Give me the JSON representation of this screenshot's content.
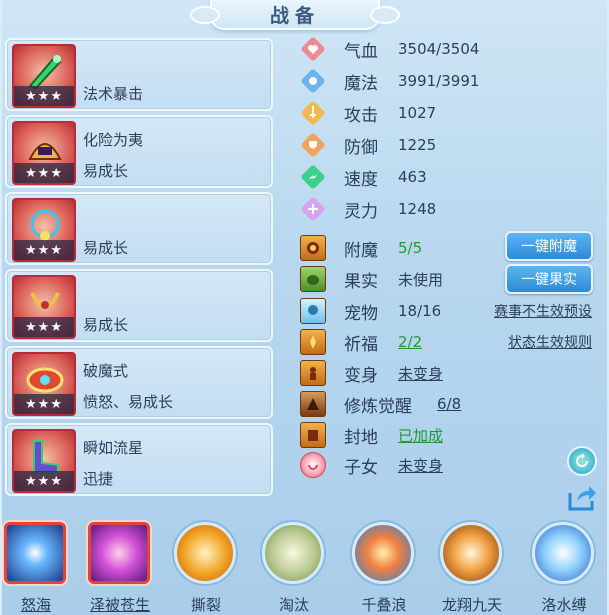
{
  "title": "战备",
  "equipment": [
    {
      "name": "",
      "attr": "法术暴击",
      "stars": "★★★"
    },
    {
      "name": "化险为夷",
      "attr": "易成长",
      "stars": "★★★"
    },
    {
      "name": "",
      "attr": "易成长",
      "stars": "★★★"
    },
    {
      "name": "",
      "attr": "易成长",
      "stars": "★★★"
    },
    {
      "name": "破魔式",
      "attr": "愤怒、易成长",
      "stars": "★★★"
    },
    {
      "name": "瞬如流星",
      "attr": "迅捷",
      "stars": "★★★"
    }
  ],
  "stats": [
    {
      "label": "气血",
      "value": "3504/3504",
      "icon": "heart-icon",
      "color": "#e85a6e"
    },
    {
      "label": "魔法",
      "value": "3991/3991",
      "icon": "mana-icon",
      "color": "#4c9be8"
    },
    {
      "label": "攻击",
      "value": "1027",
      "icon": "sword-icon",
      "color": "#f0a33a"
    },
    {
      "label": "防御",
      "value": "1225",
      "icon": "shield-icon",
      "color": "#f08a3a"
    },
    {
      "label": "速度",
      "value": "463",
      "icon": "speed-icon",
      "color": "#2fbf7a"
    },
    {
      "label": "灵力",
      "value": "1248",
      "icon": "spirit-icon",
      "color": "#c58be6"
    }
  ],
  "extras": [
    {
      "label": "附魔",
      "value": "5/5"
    },
    {
      "label": "果实",
      "value": "未使用"
    },
    {
      "label": "宠物",
      "value": "18/16"
    },
    {
      "label": "祈福",
      "value": "2/2"
    },
    {
      "label": "变身",
      "value": "未变身"
    },
    {
      "label": "修炼觉醒",
      "value": "6/8"
    },
    {
      "label": "封地",
      "value": "已加成"
    },
    {
      "label": "子女",
      "value": "未变身"
    }
  ],
  "buttons": {
    "one_click_enchant": "一键附魔",
    "one_click_fruit": "一键果实"
  },
  "links": {
    "event_preset": "赛事不生效预设",
    "status_rules": "状态生效规则"
  },
  "skills": [
    {
      "name": "怒海",
      "color": "#3a7fe0"
    },
    {
      "name": "泽被苍生",
      "color": "#c03ad0"
    },
    {
      "name": "撕裂",
      "color": "#f0a020"
    },
    {
      "name": "淘汰",
      "color": "#8fae6a"
    },
    {
      "name": "千叠浪",
      "color": "#3aa0e8"
    },
    {
      "name": "龙翔九天",
      "color": "#f09a30"
    },
    {
      "name": "洛水缚",
      "color": "#4a90e2"
    }
  ]
}
